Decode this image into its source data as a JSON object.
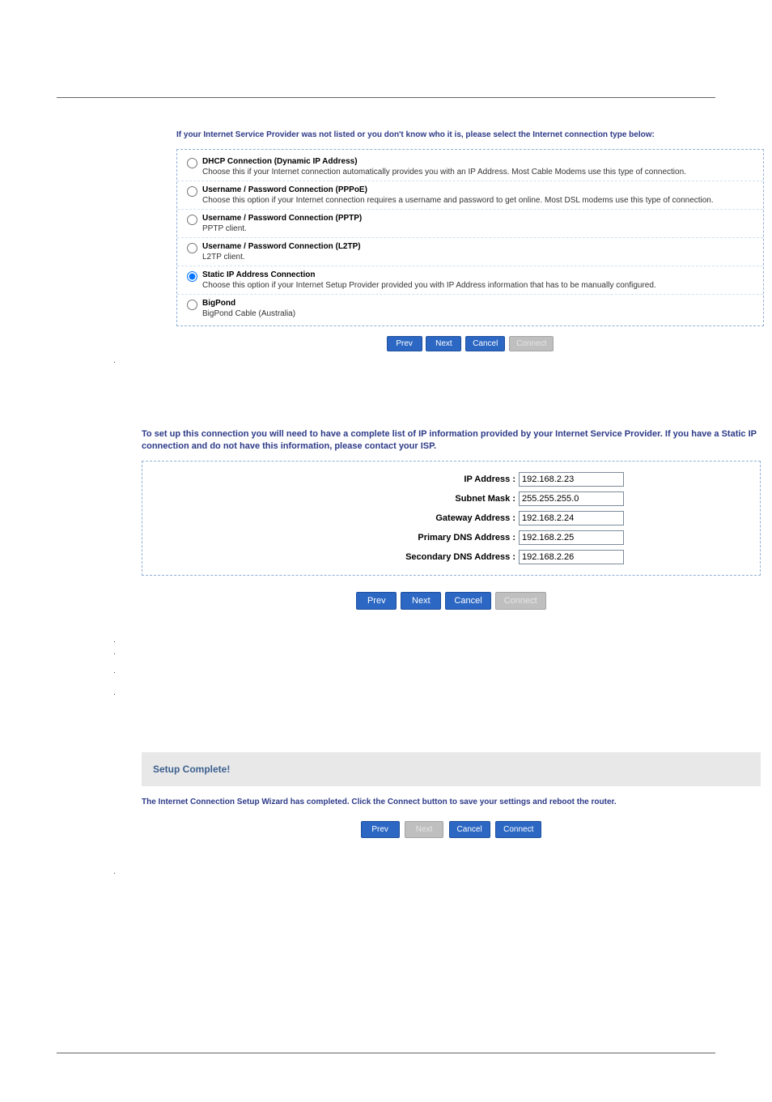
{
  "section1": {
    "title": "If your Internet Service Provider was not listed or you don't know who it is, please select the Internet connection type below:",
    "options": [
      {
        "title": "DHCP Connection (Dynamic IP Address)",
        "desc": "Choose this if your Internet connection automatically provides you with an IP Address. Most Cable Modems use this type of connection.",
        "checked": false
      },
      {
        "title": "Username / Password Connection (PPPoE)",
        "desc": "Choose this option if your Internet connection requires a username and password to get online. Most DSL modems use this type of connection.",
        "checked": false
      },
      {
        "title": "Username / Password Connection (PPTP)",
        "desc": "PPTP client.",
        "checked": false
      },
      {
        "title": "Username / Password Connection (L2TP)",
        "desc": "L2TP client.",
        "checked": false
      },
      {
        "title": "Static IP Address Connection",
        "desc": "Choose this option if your Internet Setup Provider provided you with IP Address information that has to be manually configured.",
        "checked": true
      },
      {
        "title": "BigPond",
        "desc": "BigPond Cable (Australia)",
        "checked": false
      }
    ],
    "buttons": {
      "prev": "Prev",
      "next": "Next",
      "cancel": "Cancel",
      "connect": "Connect"
    }
  },
  "section2": {
    "title": "To set up this connection you will need to have a complete list of IP information provided by your Internet Service Provider. If you have a Static IP connection and do not have this information, please contact your ISP.",
    "fields": [
      {
        "label": "IP Address :",
        "value": "192.168.2.23"
      },
      {
        "label": "Subnet Mask :",
        "value": "255.255.255.0"
      },
      {
        "label": "Gateway Address :",
        "value": "192.168.2.24"
      },
      {
        "label": "Primary DNS Address :",
        "value": "192.168.2.25"
      },
      {
        "label": "Secondary DNS Address :",
        "value": "192.168.2.26"
      }
    ],
    "buttons": {
      "prev": "Prev",
      "next": "Next",
      "cancel": "Cancel",
      "connect": "Connect"
    }
  },
  "section3": {
    "heading": "Setup Complete!",
    "text": "The Internet Connection Setup Wizard has completed. Click the Connect button to save your settings and reboot the router.",
    "buttons": {
      "prev": "Prev",
      "next": "Next",
      "cancel": "Cancel",
      "connect": "Connect"
    }
  }
}
